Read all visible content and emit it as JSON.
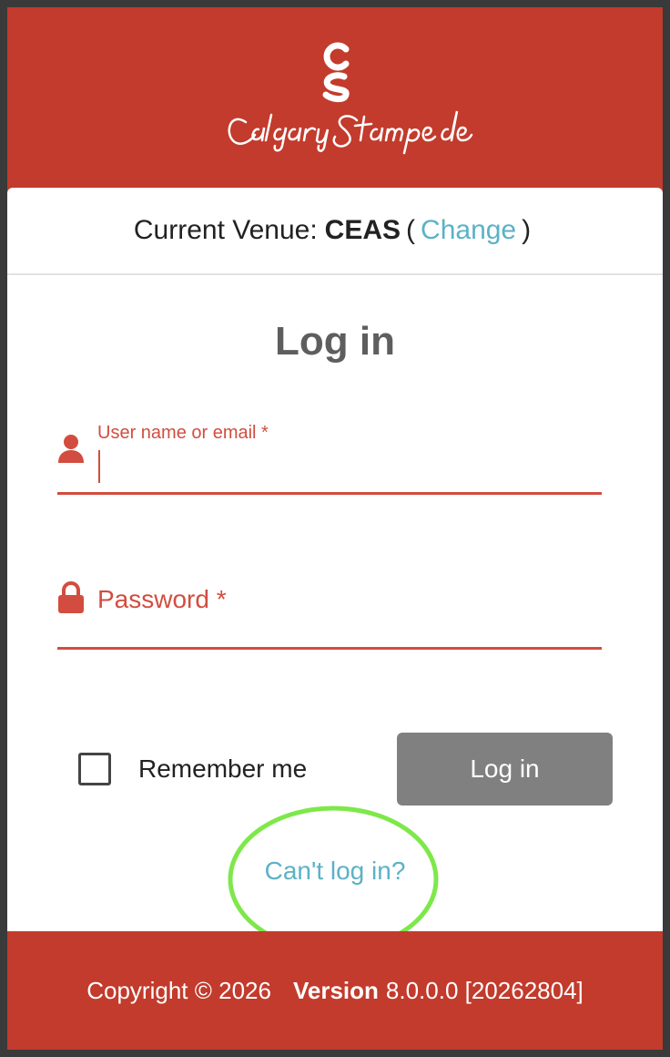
{
  "brand": {
    "monogram": "CS",
    "name": "Calgary Stampede",
    "color": "#c23b2c"
  },
  "venue": {
    "prefix": "Current Venue:",
    "code": "CEAS",
    "open_paren": "(",
    "change_link": "Change",
    "close_paren": ")"
  },
  "form": {
    "title": "Log in",
    "username_label": "User name or email *",
    "username_value": "",
    "password_placeholder": "Password *",
    "password_value": "",
    "remember_label": "Remember me",
    "remember_checked": false,
    "submit_label": "Log in",
    "cant_login_link": "Can't log in?"
  },
  "footer": {
    "copyright": "Copyright © 2026",
    "version_label": "Version",
    "version_value": "8.0.0.0 [20262804]"
  },
  "icons": {
    "user": "user-icon",
    "lock": "lock-icon"
  },
  "colors": {
    "accent_red": "#d24d3f",
    "link_blue": "#5bb2c6",
    "button_gray": "#808080",
    "highlight_green": "#7ee84a"
  }
}
